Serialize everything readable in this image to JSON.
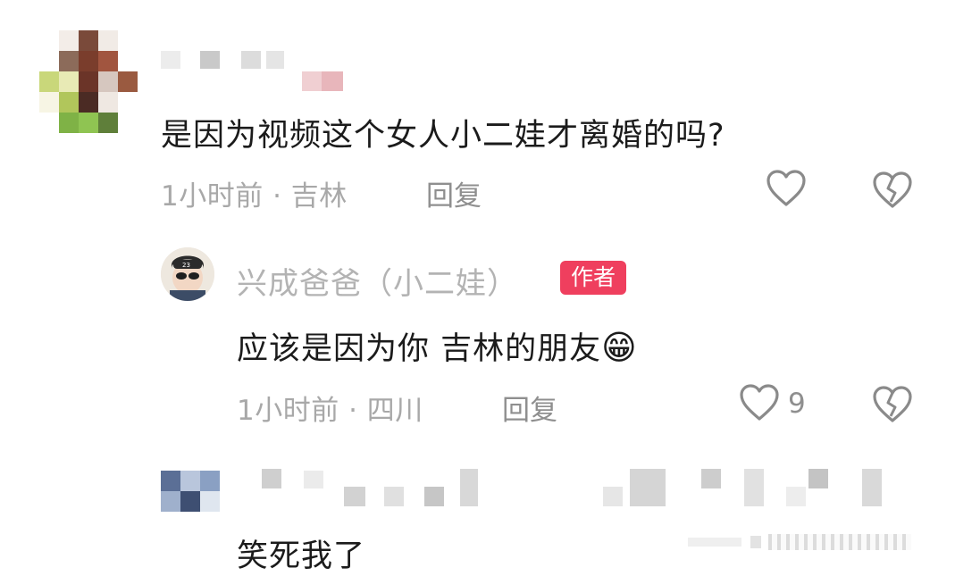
{
  "colors": {
    "badge": "#ef3f5e",
    "text": "#1b1b1b",
    "meta": "#a8a8a8"
  },
  "comments": [
    {
      "content": "是因为视频这个女人小二娃才离婚的吗?",
      "meta": "1小时前 · 吉林",
      "reply_label": "回复",
      "like_icon": "heart-outline-icon",
      "dislike_icon": "broken-heart-icon"
    },
    {
      "username": "兴成爸爸（小二娃）",
      "badge": "作者",
      "content": "应该是因为你 吉林的朋友",
      "emoji": "😁",
      "meta": "1小时前 · 四川",
      "reply_label": "回复",
      "like_count": "9",
      "like_icon": "heart-outline-icon",
      "dislike_icon": "broken-heart-icon"
    },
    {
      "content": "笑死我了"
    }
  ]
}
